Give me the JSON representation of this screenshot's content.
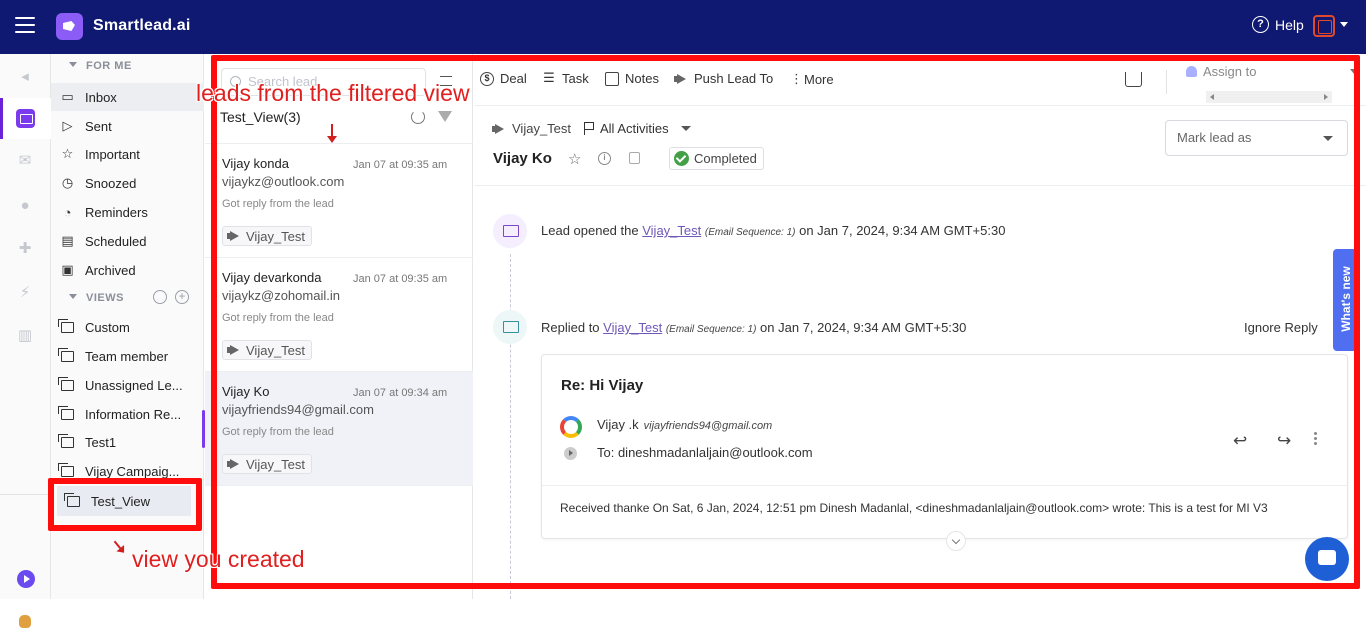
{
  "topbar": {
    "brand": "Smartlead.ai",
    "help_label": "Help"
  },
  "nav": {
    "for_me_heading": "FOR ME",
    "items": [
      {
        "label": "Inbox",
        "icon": "inbox-icon"
      },
      {
        "label": "Sent",
        "icon": "send-icon"
      },
      {
        "label": "Important",
        "icon": "star-icon"
      },
      {
        "label": "Snoozed",
        "icon": "alarm-icon"
      },
      {
        "label": "Reminders",
        "icon": "clock-icon"
      },
      {
        "label": "Scheduled",
        "icon": "scheduled-icon"
      },
      {
        "label": "Archived",
        "icon": "archive-icon"
      }
    ],
    "views_heading": "VIEWS",
    "views": [
      {
        "label": "Custom"
      },
      {
        "label": "Team member"
      },
      {
        "label": "Unassigned Le..."
      },
      {
        "label": "Information Re..."
      },
      {
        "label": "Test1"
      },
      {
        "label": "Vijay Campaig..."
      },
      {
        "label": "Test_View"
      }
    ]
  },
  "list": {
    "search_placeholder": "Search lead",
    "title": "Test_View(3)",
    "leads": [
      {
        "name": "Vijay konda",
        "date": "Jan 07 at 09:35 am",
        "email": "vijaykz@outlook.com",
        "status": "Got reply from the lead",
        "tag": "Vijay_Test"
      },
      {
        "name": "Vijay devarkonda",
        "date": "Jan 07 at 09:35 am",
        "email": "vijaykz@zohomail.in",
        "status": "Got reply from the lead",
        "tag": "Vijay_Test"
      },
      {
        "name": "Vijay Ko",
        "date": "Jan 07 at 09:34 am",
        "email": "vijayfriends94@gmail.com",
        "status": "Got reply from the lead",
        "tag": "Vijay_Test"
      }
    ]
  },
  "toolbar": {
    "deal": "Deal",
    "task": "Task",
    "notes": "Notes",
    "push_lead": "Push Lead To",
    "more": "More",
    "assign_placeholder": "Assign to"
  },
  "detail": {
    "campaign": "Vijay_Test",
    "activities": "All Activities",
    "lead_name": "Vijay Ko",
    "status": "Completed",
    "mark_lead_placeholder": "Mark lead as"
  },
  "timeline": [
    {
      "prefix": "Lead opened the",
      "campaign": "Vijay_Test",
      "sequence": "(Email Sequence: 1)",
      "suffix": "on Jan 7, 2024, 9:34 AM GMT+5:30"
    },
    {
      "prefix": "Replied to",
      "campaign": "Vijay_Test",
      "sequence": "(Email Sequence: 1)",
      "suffix": "on Jan 7, 2024, 9:34 AM GMT+5:30"
    }
  ],
  "ignore_reply": "Ignore Reply",
  "email": {
    "subject": "Re: Hi Vijay",
    "from_name": "Vijay .k",
    "from_email": "vijayfriends94@gmail.com",
    "to": "To: dineshmadanlaljain@outlook.com",
    "body": "Received thanke On Sat, 6 Jan, 2024, 12:51 pm Dinesh Madanlal, <dineshmadanlaljain@outlook.com> wrote: This is a test for MI V3"
  },
  "whats_new": "What's new",
  "annotations": {
    "leads_note": "leads from the filtered view",
    "view_note": "view you created"
  },
  "colors": {
    "topbar": "#0f1971",
    "accent": "#7c3aed",
    "annotation": "#ff0d0d"
  }
}
